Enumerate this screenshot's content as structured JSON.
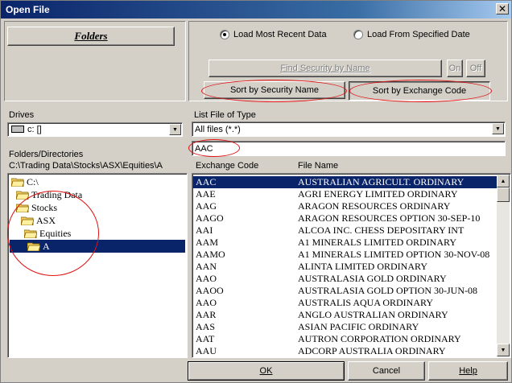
{
  "window": {
    "title": "Open File",
    "close_glyph": "✕"
  },
  "folders_button": "Folders",
  "load_options": [
    {
      "label": "Load Most Recent Data",
      "checked": true
    },
    {
      "label": "Load From Specified Date",
      "checked": false
    }
  ],
  "find_security_button": "Find Security by Name",
  "on_button": "On",
  "off_button": "Off",
  "sort_name_button": "Sort by Security Name",
  "sort_code_button": "Sort by Exchange Code",
  "drives": {
    "label": "Drives",
    "value": "c: []"
  },
  "file_type": {
    "label": "List File of Type",
    "value": "All files (*.*)"
  },
  "search_value": "AAC",
  "folders_directories": {
    "label": "Folders/Directories",
    "path": "C:\\Trading Data\\Stocks\\ASX\\Equities\\A"
  },
  "tree": [
    {
      "label": "C:\\"
    },
    {
      "label": "Trading Data"
    },
    {
      "label": "Stocks"
    },
    {
      "label": "ASX"
    },
    {
      "label": "Equities"
    },
    {
      "label": "A"
    }
  ],
  "list": {
    "headers": [
      "Exchange Code",
      "File Name"
    ],
    "rows": [
      {
        "code": "AAC",
        "name": "AUSTRALIAN AGRICULT. ORDINARY"
      },
      {
        "code": "AAE",
        "name": "AGRI ENERGY LIMITED ORDINARY"
      },
      {
        "code": "AAG",
        "name": "ARAGON RESOURCES ORDINARY"
      },
      {
        "code": "AAGO",
        "name": "ARAGON RESOURCES OPTION 30-SEP-10"
      },
      {
        "code": "AAI",
        "name": "ALCOA INC. CHESS DEPOSITARY INT"
      },
      {
        "code": "AAM",
        "name": "A1 MINERALS LIMITED ORDINARY"
      },
      {
        "code": "AAMO",
        "name": "A1 MINERALS LIMITED OPTION 30-NOV-08"
      },
      {
        "code": "AAN",
        "name": "ALINTA LIMITED ORDINARY"
      },
      {
        "code": "AAO",
        "name": "AUSTRALASIA GOLD ORDINARY"
      },
      {
        "code": "AAOO",
        "name": "AUSTRALASIA GOLD OPTION 30-JUN-08"
      },
      {
        "code": "AAO",
        "name": "AUSTRALIS AQUA ORDINARY"
      },
      {
        "code": "AAR",
        "name": "ANGLO AUSTRALIAN ORDINARY"
      },
      {
        "code": "AAS",
        "name": "ASIAN PACIFIC ORDINARY"
      },
      {
        "code": "AAT",
        "name": "AUTRON CORPORATION ORDINARY"
      },
      {
        "code": "AAU",
        "name": "ADCORP AUSTRALIA ORDINARY"
      }
    ]
  },
  "ok_button": "OK",
  "cancel_button": "Cancel",
  "help_button": "Help",
  "colors": {
    "selection": "#0a246a",
    "annotation": "#e01010",
    "face": "#d4d0c8"
  }
}
